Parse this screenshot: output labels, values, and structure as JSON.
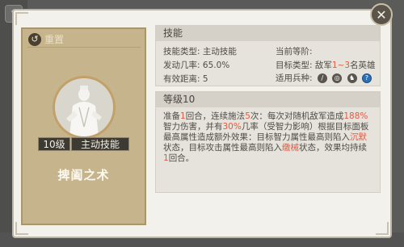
{
  "left_panel": {
    "reset_label": "重置",
    "level": "10级",
    "skill_type_badge": "主动技能",
    "skill_name": "捭阖之术"
  },
  "skill_section": {
    "header": "技能",
    "skill_type_label": "技能类型:",
    "skill_type_value": "主动技能",
    "current_level_label": "当前等阶:",
    "trigger_rate_label": "发动几率:",
    "trigger_rate_value": "65.0%",
    "target_type_label": "目标类型:",
    "target_type_prefix": "敌军",
    "target_type_range": "1~3",
    "target_type_suffix": "名英雄",
    "range_label": "有效距离:",
    "range_value": "5",
    "unit_types_label": "适用兵种:",
    "unit_icons": [
      "spear-icon",
      "bow-icon",
      "horse-icon",
      "question-icon"
    ]
  },
  "level_section": {
    "header": "等级10",
    "desc_parts": [
      "准备",
      "1",
      "回合，连续施法",
      "5",
      "次：每次对随机敌军造成",
      "188%",
      "智力伤害，并有",
      "30%",
      "几率（受智力影响）根据目标面板最高属性造成额外效果：目标智力属性最高则陷入",
      "沉默",
      "状态，目标攻击属性最高则陷入",
      "缴械",
      "状态，效果均持续",
      "1",
      "回合。"
    ]
  },
  "colors": {
    "highlight": "#e2593f",
    "panel_bg": "#f3f1ec",
    "card_bg": "#c6b58c"
  }
}
